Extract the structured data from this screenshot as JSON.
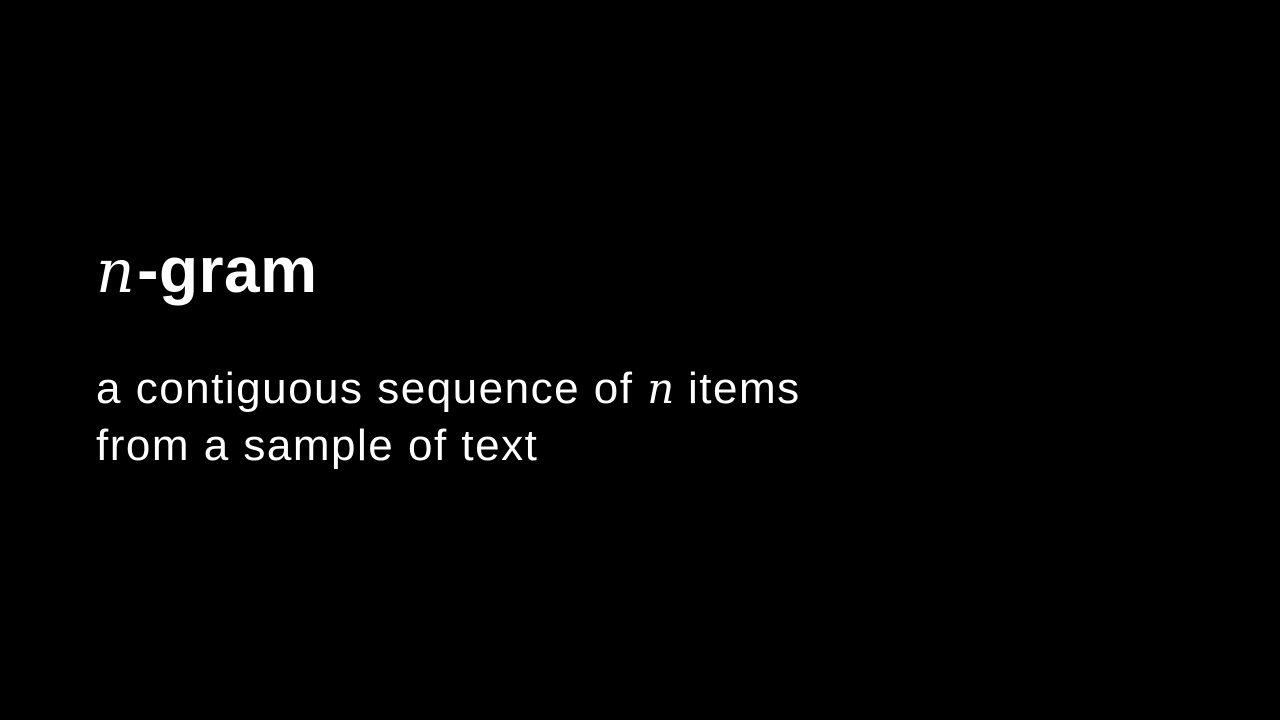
{
  "term": {
    "variable": "n",
    "suffix": "-gram"
  },
  "definition": {
    "line1_before": "a contiguous sequence of ",
    "line1_variable": "n",
    "line1_after": " items",
    "line2": "from a sample of text"
  },
  "colors": {
    "background": "#000000",
    "text": "#ffffff"
  }
}
